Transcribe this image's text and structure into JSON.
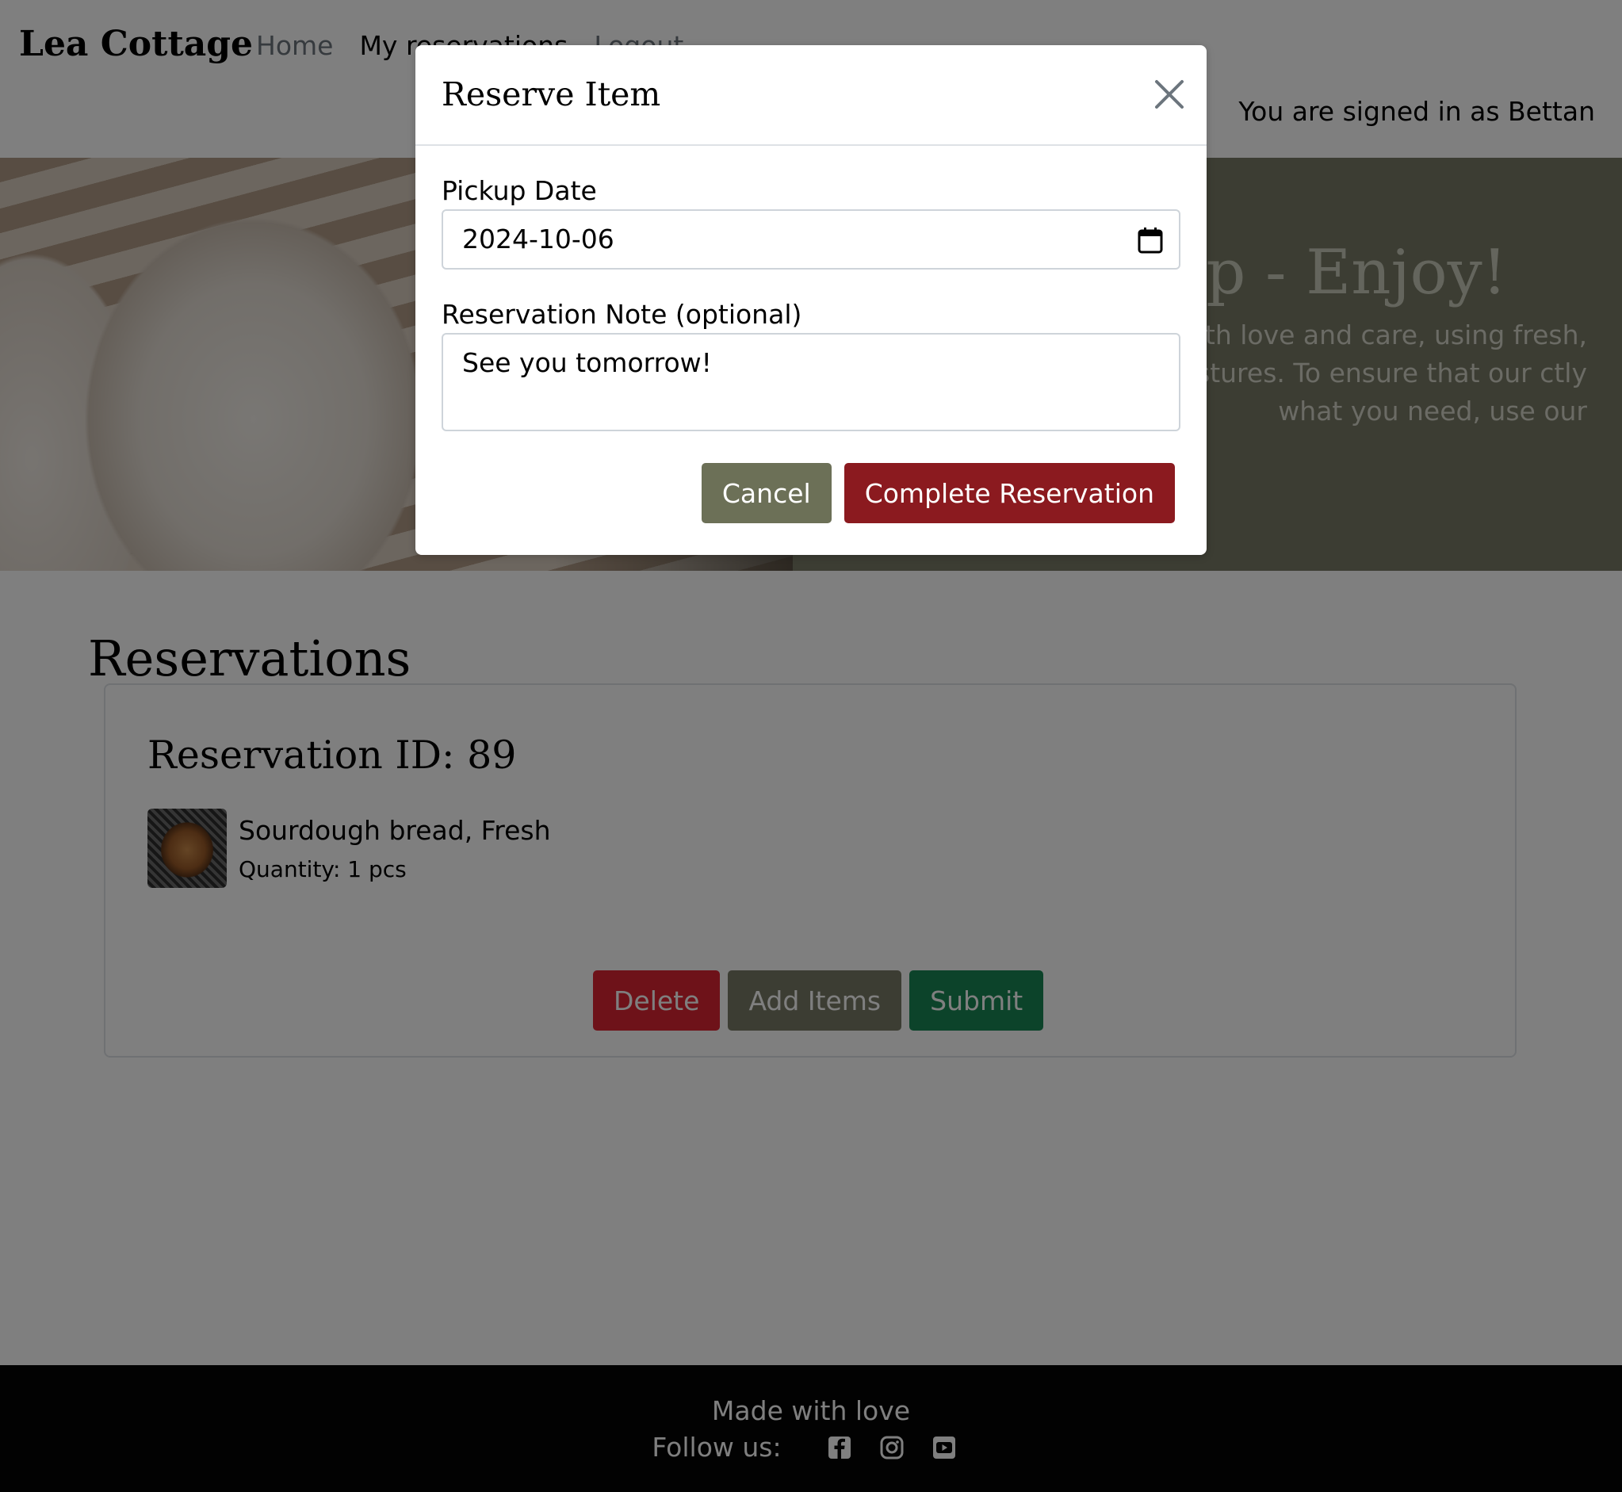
{
  "navbar": {
    "brand": "Lea Cottage",
    "links": [
      "Home",
      "My reservations",
      "Logout"
    ],
    "signed_in": "You are signed in as Bettan"
  },
  "hero": {
    "title_visible": "Up - Enjoy!",
    "text_visible": "with love and care, using fresh, pastures. To ensure that our ctly what you need, use our"
  },
  "main": {
    "title": "Reservations",
    "card": {
      "title": "Reservation ID: 89",
      "item_name": "Sourdough bread, Fresh",
      "item_qty": "Quantity: 1 pcs",
      "buttons": {
        "delete": "Delete",
        "add": "Add Items",
        "submit": "Submit"
      }
    }
  },
  "footer": {
    "made": "Made with love",
    "follow": "Follow us:",
    "icons": [
      "facebook-icon",
      "instagram-icon",
      "youtube-icon"
    ]
  },
  "modal": {
    "title": "Reserve Item",
    "date_label": "Pickup Date",
    "date_value": "2024-10-06",
    "note_label": "Reservation Note (optional)",
    "note_value": "See you tomorrow!",
    "cancel": "Cancel",
    "complete": "Complete Reservation"
  },
  "colors": {
    "brand_red": "#8b1a1f",
    "olive": "#787a66",
    "delete_red": "#dc2433",
    "submit_green": "#198754"
  }
}
